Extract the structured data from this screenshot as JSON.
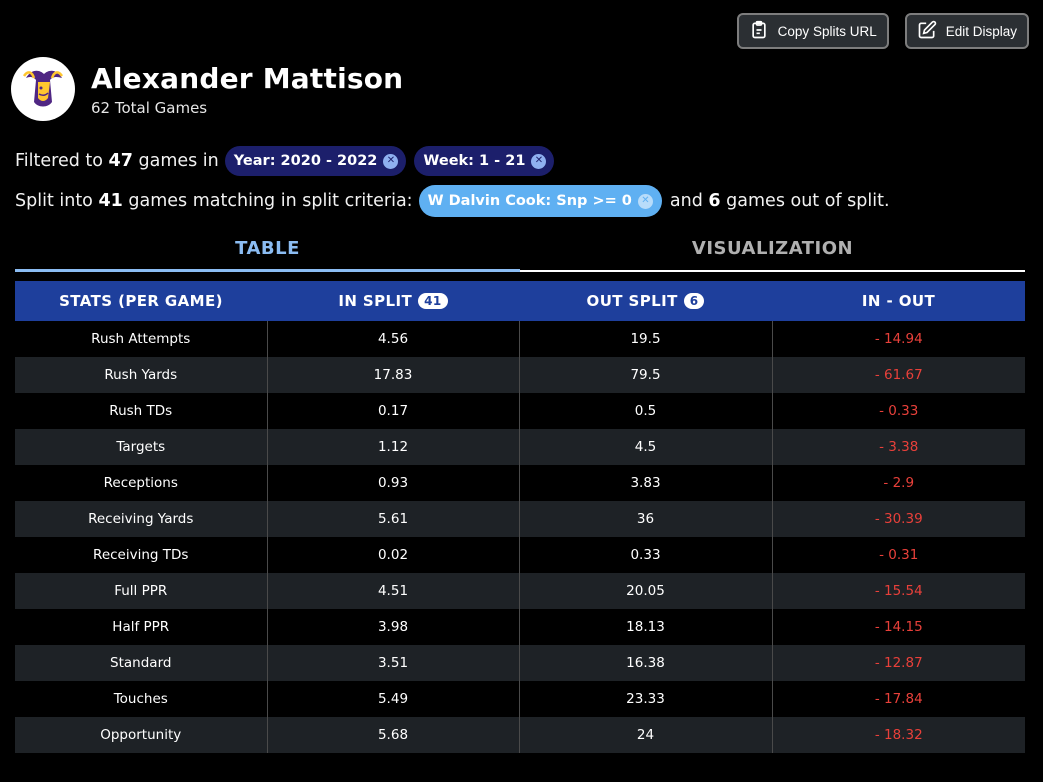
{
  "actions": {
    "copy_url_label": "Copy Splits URL",
    "edit_display_label": "Edit Display"
  },
  "player": {
    "name": "Alexander Mattison",
    "total_games": "62 Total Games",
    "team_logo_icon": "vikings-logo"
  },
  "filter": {
    "prefix": "Filtered to",
    "count": "47",
    "suffix": "games in",
    "chips": [
      "Year: 2020 - 2022",
      "Week: 1 - 21"
    ]
  },
  "split": {
    "prefix": "Split into",
    "in_count": "41",
    "middle": "games matching in split criteria:",
    "chip": "W Dalvin Cook: Snp >= 0",
    "and_text": "and",
    "out_count": "6",
    "suffix": "games out of split."
  },
  "tabs": [
    {
      "label": "TABLE",
      "active": true
    },
    {
      "label": "VISUALIZATION",
      "active": false
    }
  ],
  "table": {
    "headers": {
      "stats": "STATS (PER GAME)",
      "in_split": "IN SPLIT",
      "in_split_count": "41",
      "out_split": "OUT SPLIT",
      "out_split_count": "6",
      "diff": "IN - OUT"
    },
    "rows": [
      {
        "stat": "Rush Attempts",
        "in": "4.56",
        "out": "19.5",
        "diff": "- 14.94"
      },
      {
        "stat": "Rush Yards",
        "in": "17.83",
        "out": "79.5",
        "diff": "- 61.67"
      },
      {
        "stat": "Rush TDs",
        "in": "0.17",
        "out": "0.5",
        "diff": "- 0.33"
      },
      {
        "stat": "Targets",
        "in": "1.12",
        "out": "4.5",
        "diff": "- 3.38"
      },
      {
        "stat": "Receptions",
        "in": "0.93",
        "out": "3.83",
        "diff": "- 2.9"
      },
      {
        "stat": "Receiving Yards",
        "in": "5.61",
        "out": "36",
        "diff": "- 30.39"
      },
      {
        "stat": "Receiving TDs",
        "in": "0.02",
        "out": "0.33",
        "diff": "- 0.31"
      },
      {
        "stat": "Full PPR",
        "in": "4.51",
        "out": "20.05",
        "diff": "- 15.54"
      },
      {
        "stat": "Half PPR",
        "in": "3.98",
        "out": "18.13",
        "diff": "- 14.15"
      },
      {
        "stat": "Standard",
        "in": "3.51",
        "out": "16.38",
        "diff": "- 12.87"
      },
      {
        "stat": "Touches",
        "in": "5.49",
        "out": "23.33",
        "diff": "- 17.84"
      },
      {
        "stat": "Opportunity",
        "in": "5.68",
        "out": "24",
        "diff": "- 18.32"
      }
    ]
  },
  "colors": {
    "header_blue": "#1e3f9c",
    "tab_active": "#8bbcf2",
    "negative_red": "#e8403a",
    "chip_dark": "#1c1f6b",
    "chip_light": "#5fb0f2"
  }
}
